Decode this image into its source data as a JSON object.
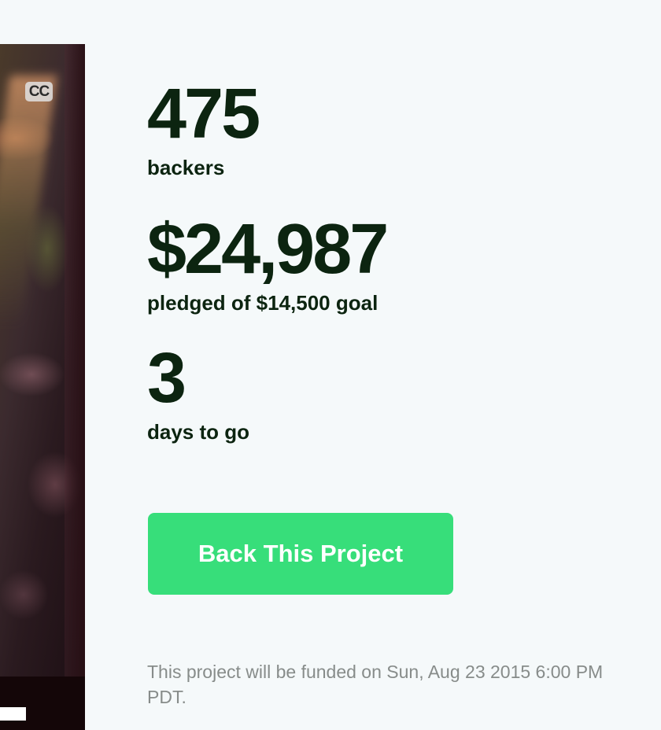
{
  "video": {
    "cc_label": "CC",
    "progress": 0.31
  },
  "stats": {
    "backers": {
      "value": "475",
      "label": "backers"
    },
    "pledged": {
      "value": "$24,987",
      "label": "pledged of $14,500 goal"
    },
    "days": {
      "value": "3",
      "label": "days to go"
    }
  },
  "cta": {
    "label": "Back This Project"
  },
  "funding_note": "This project will be funded on Sun, Aug 23 2015 6:00 PM PDT.",
  "colors": {
    "background": "#f5f9fa",
    "text_dark": "#0c2410",
    "accent_green": "#37de7a",
    "note_gray": "#878c8a"
  }
}
